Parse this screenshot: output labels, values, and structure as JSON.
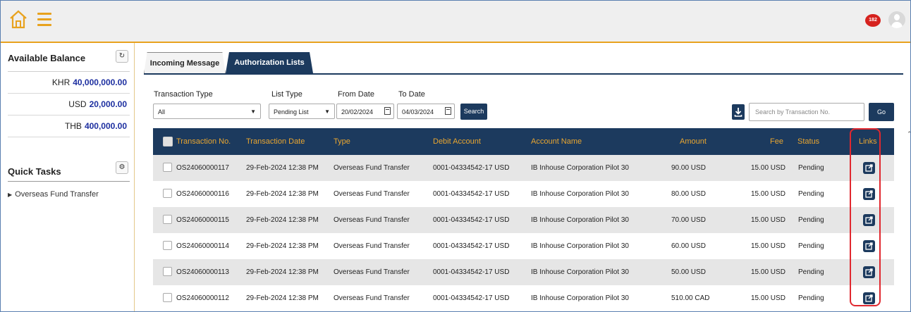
{
  "header": {
    "notification_count": "182"
  },
  "sidebar": {
    "balance_title": "Available Balance",
    "balances": [
      {
        "currency": "KHR",
        "amount": "40,000,000.00"
      },
      {
        "currency": "USD",
        "amount": "20,000.00"
      },
      {
        "currency": "THB",
        "amount": "400,000.00"
      }
    ],
    "quick_tasks_title": "Quick Tasks",
    "quick_tasks": [
      "Overseas Fund Transfer"
    ]
  },
  "tabs": {
    "incoming": "Incoming Message",
    "authorization": "Authorization Lists"
  },
  "filters": {
    "transaction_type_label": "Transaction Type",
    "transaction_type_value": "All",
    "list_type_label": "List Type",
    "list_type_value": "Pending List",
    "from_date_label": "From Date",
    "from_date_value": "20/02/2024",
    "to_date_label": "To Date",
    "to_date_value": "04/03/2024",
    "search_button": "Search",
    "search_placeholder": "Search by Transaction No.",
    "go_button": "Go"
  },
  "table": {
    "headers": {
      "txn_no": "Transaction No.",
      "txn_date": "Transaction Date",
      "type": "Type",
      "debit_account": "Debit Account",
      "account_name": "Account Name",
      "amount": "Amount",
      "fee": "Fee",
      "status": "Status",
      "links": "Links"
    },
    "rows": [
      {
        "txn_no": "OS24060000117",
        "txn_date": "29-Feb-2024 12:38 PM",
        "type": "Overseas Fund Transfer",
        "debit_account": "0001-04334542-17 USD",
        "account_name": "IB Inhouse Corporation Pilot 30",
        "amount": "90.00 USD",
        "fee": "15.00 USD",
        "status": "Pending"
      },
      {
        "txn_no": "OS24060000116",
        "txn_date": "29-Feb-2024 12:38 PM",
        "type": "Overseas Fund Transfer",
        "debit_account": "0001-04334542-17 USD",
        "account_name": "IB Inhouse Corporation Pilot 30",
        "amount": "80.00 USD",
        "fee": "15.00 USD",
        "status": "Pending"
      },
      {
        "txn_no": "OS24060000115",
        "txn_date": "29-Feb-2024 12:38 PM",
        "type": "Overseas Fund Transfer",
        "debit_account": "0001-04334542-17 USD",
        "account_name": "IB Inhouse Corporation Pilot 30",
        "amount": "70.00 USD",
        "fee": "15.00 USD",
        "status": "Pending"
      },
      {
        "txn_no": "OS24060000114",
        "txn_date": "29-Feb-2024 12:38 PM",
        "type": "Overseas Fund Transfer",
        "debit_account": "0001-04334542-17 USD",
        "account_name": "IB Inhouse Corporation Pilot 30",
        "amount": "60.00 USD",
        "fee": "15.00 USD",
        "status": "Pending"
      },
      {
        "txn_no": "OS24060000113",
        "txn_date": "29-Feb-2024 12:38 PM",
        "type": "Overseas Fund Transfer",
        "debit_account": "0001-04334542-17 USD",
        "account_name": "IB Inhouse Corporation Pilot 30",
        "amount": "50.00 USD",
        "fee": "15.00 USD",
        "status": "Pending"
      },
      {
        "txn_no": "OS24060000112",
        "txn_date": "29-Feb-2024 12:38 PM",
        "type": "Overseas Fund Transfer",
        "debit_account": "0001-04334542-17 USD",
        "account_name": "IB Inhouse Corporation Pilot 30",
        "amount": "510.00 CAD",
        "fee": "15.00 USD",
        "status": "Pending"
      }
    ]
  },
  "colors": {
    "accent": "#e8a21e",
    "navy": "#1c3a5e",
    "highlight": "#e0282f",
    "notification": "#d6221e"
  },
  "icons": [
    "home-icon",
    "hamburger-menu-icon",
    "notification-icon",
    "user-avatar-icon",
    "refresh-icon",
    "settings-icon",
    "calendar-icon",
    "download-icon",
    "external-link-icon"
  ]
}
